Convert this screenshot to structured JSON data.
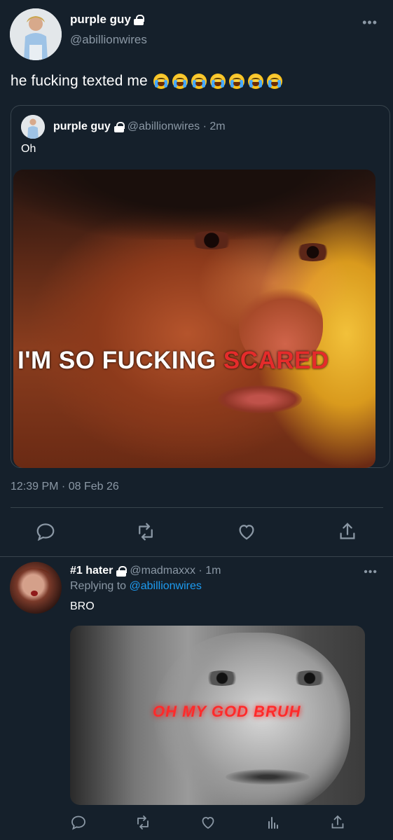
{
  "main_tweet": {
    "display_name": "purple guy",
    "handle": "@abillionwires",
    "text": "he fucking texted me",
    "emoji_count": 7,
    "emoji_icon": "loudly-crying-face-icon",
    "timestamp": "12:39 PM · 08 Feb 26",
    "quoted": {
      "display_name": "purple guy",
      "handle": "@abillionwires · 2m",
      "text": "Oh",
      "media_caption_white": "I'M SO FUCKING ",
      "media_caption_red": "SCARED"
    },
    "actions": [
      "reply-icon",
      "retweet-icon",
      "like-icon",
      "share-icon"
    ]
  },
  "reply_tweet": {
    "display_name": "#1 hater",
    "handle": "@madmaxxx · 1m",
    "replying_label": "Replying to",
    "replying_handle": "@abillionwires",
    "text": "BRO",
    "media_caption": "OH MY GOD BRUH",
    "actions": [
      "reply-icon",
      "retweet-icon",
      "like-icon",
      "analytics-icon",
      "share-icon"
    ]
  },
  "colors": {
    "background": "#15202b",
    "divider": "#38444d",
    "muted": "#8b98a5",
    "link": "#1d9bf0",
    "caption_red": "#e52b2b"
  }
}
